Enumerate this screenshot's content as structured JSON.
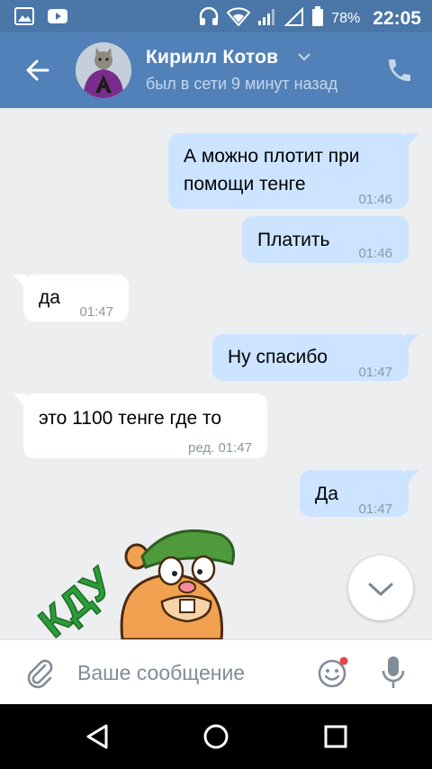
{
  "status_bar": {
    "battery_percent": "78%",
    "time": "22:05",
    "icons": [
      "gallery-icon",
      "youtube-icon",
      "headphones-icon",
      "wifi-icon",
      "signal-icon",
      "signal-empty-icon",
      "battery-icon"
    ]
  },
  "header": {
    "contact_name": "Кирилл Котов",
    "last_seen": "был в сети 9 минут назад",
    "icons": [
      "back-arrow-icon",
      "dropdown-chevron-icon",
      "phone-icon"
    ]
  },
  "messages": [
    {
      "direction": "out",
      "lines": [
        "А можно плотит при",
        "помощи тенге"
      ],
      "time": "01:46"
    },
    {
      "direction": "out",
      "lines": [
        "Платить"
      ],
      "time": "01:46"
    },
    {
      "direction": "in",
      "lines": [
        "да"
      ],
      "time": "01:47"
    },
    {
      "direction": "out",
      "lines": [
        "Ну спасибо"
      ],
      "time": "01:47"
    },
    {
      "direction": "in",
      "lines": [
        "это 1100 тенге где то"
      ],
      "time": "ред. 01:47"
    },
    {
      "direction": "out",
      "lines": [
        "Да"
      ],
      "time": "01:47"
    }
  ],
  "sticker": {
    "icon": "hamster-sticker-icon",
    "caption": "КДУ"
  },
  "scroll_down": {
    "icon": "chevron-down-icon"
  },
  "composer": {
    "placeholder": "Ваше сообщение",
    "icons": [
      "paperclip-icon",
      "emoji-icon",
      "microphone-icon"
    ]
  },
  "navigation": {
    "icons": [
      "nav-back-icon",
      "nav-home-icon",
      "nav-recents-icon"
    ]
  },
  "colors": {
    "header": "#5181b8",
    "status_bar": "#4a76a8",
    "outgoing_bubble": "#cce4ff",
    "incoming_bubble": "#ffffff",
    "background": "#edeef0"
  }
}
